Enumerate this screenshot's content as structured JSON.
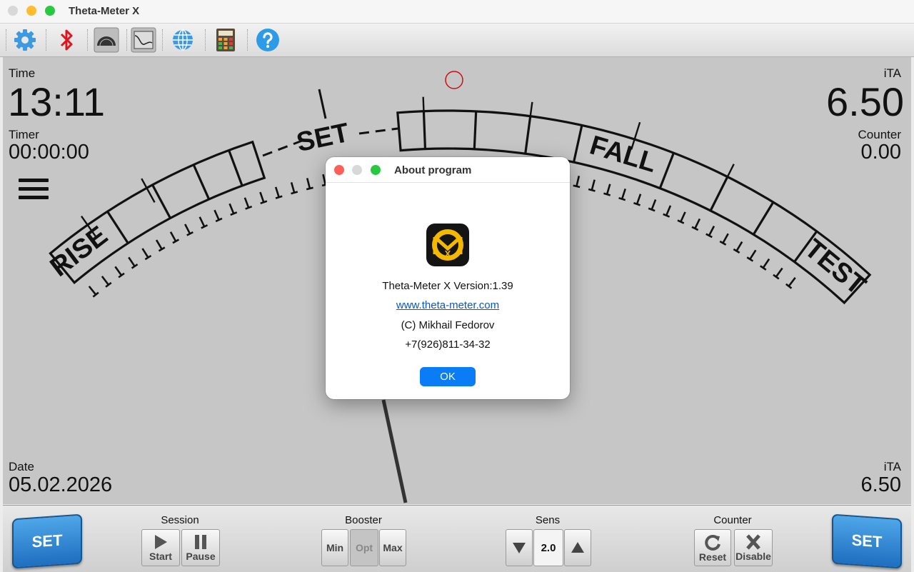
{
  "window": {
    "title": "Theta-Meter X",
    "controls": [
      "close",
      "minimize",
      "zoom"
    ]
  },
  "toolbar": {
    "items": [
      {
        "icon": "gear-icon"
      },
      {
        "icon": "bluetooth-icon"
      },
      {
        "icon": "gauge-icon"
      },
      {
        "icon": "graph-icon"
      },
      {
        "icon": "globe-icon"
      },
      {
        "icon": "calculator-icon"
      },
      {
        "icon": "help-icon"
      }
    ]
  },
  "gauge": {
    "zones": {
      "rise": "RISE",
      "set": "SET",
      "fall": "FALL",
      "test": "TEST"
    }
  },
  "readouts": {
    "time_label": "Time",
    "time_value": "13:11",
    "timer_label": "Timer",
    "timer_value": "00:00:00",
    "ita_label": "iTA",
    "ita_value": "6.50",
    "counter_label": "Counter",
    "counter_value": "0.00",
    "date_label": "Date",
    "date_value": "05.02.2026",
    "ita2_label": "iTA",
    "ita2_value": "6.50"
  },
  "bottom": {
    "set_left": "SET",
    "set_right": "SET",
    "session_label": "Session",
    "start_label": "Start",
    "pause_label": "Pause",
    "booster_label": "Booster",
    "booster_min": "Min",
    "booster_opt": "Opt",
    "booster_max": "Max",
    "sens_label": "Sens",
    "sens_value": "2.0",
    "counter_label": "Counter",
    "reset_label": "Reset",
    "disable_label": "Disable"
  },
  "dialog": {
    "title": "About program",
    "version_text": "Theta-Meter X Version:1.39",
    "website": "www.theta-meter.com",
    "copyright": "(C) Mikhail Fedorov",
    "phone": "+7(926)811-34-32",
    "ok_label": "OK",
    "colors": {
      "ok_button": "#0a7cf5",
      "link": "#0b57c2"
    }
  }
}
